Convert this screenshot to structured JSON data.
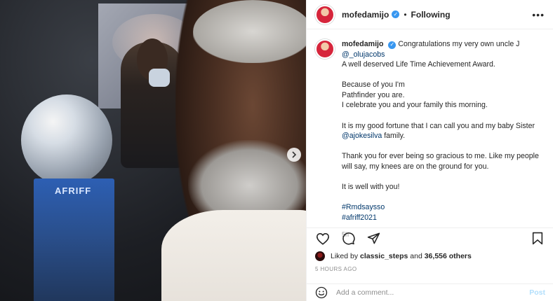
{
  "post": {
    "username": "mofedamijo",
    "follow_status": "Following",
    "separator": "•",
    "more_icon": "more-options-icon",
    "photo": {
      "trophy_text": "AFRIFF",
      "carousel_next_icon": "chevron-right-icon"
    }
  },
  "caption": {
    "username": "mofedamijo",
    "line1_a": "Congratulations my very own uncle J ",
    "line1_mention": "@_olujacobs",
    "line2": "A well deserved Life Time Achievement Award.",
    "para2_l1": "Because of you I'm",
    "para2_l2": "Pathfinder you are.",
    "para2_l3": "I celebrate you and your family this morning.",
    "para3_a": "It is my good fortune that I can call you and my baby Sister",
    "para3_mention": "@ajokesilva",
    "para3_b": " family.",
    "para4": "Thank you for ever being so gracious to me. Like my people will say, my knees are on the ground for you.",
    "para5": "It is well with you!",
    "hashtag1": "#Rmdsaysso",
    "hashtag2": "#afriff2021",
    "time": "5h"
  },
  "likes": {
    "prefix": "Liked by ",
    "user": "classic_steps",
    "middle": " and ",
    "count": "36,556 others"
  },
  "posted_ago": "5 HOURS AGO",
  "comment": {
    "placeholder": "Add a comment...",
    "post_label": "Post"
  },
  "colors": {
    "link": "#00376b",
    "verified": "#3897f0",
    "post_disabled": "#b2dffc",
    "muted": "#8e8e8e"
  }
}
